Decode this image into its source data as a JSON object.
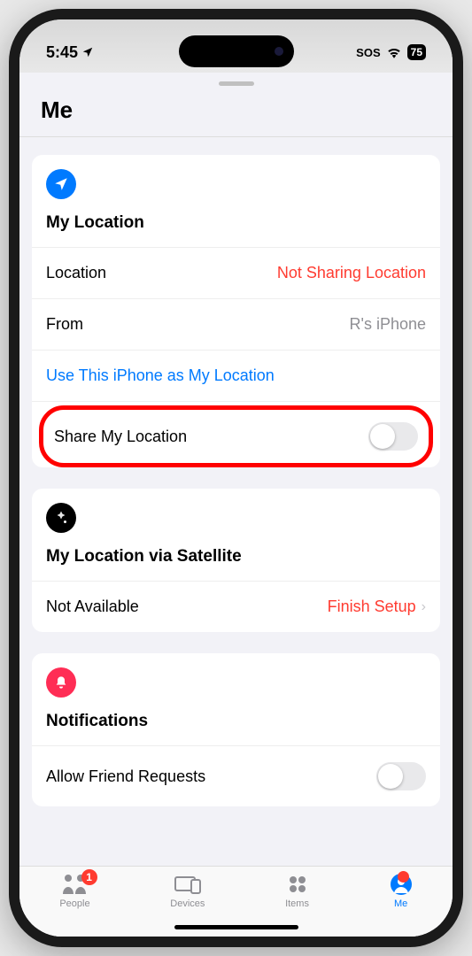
{
  "statusBar": {
    "time": "5:45",
    "sos": "SOS",
    "battery": "75"
  },
  "pageTitle": "Me",
  "locationCard": {
    "heading": "My Location",
    "rows": {
      "location": {
        "label": "Location",
        "value": "Not Sharing Location"
      },
      "from": {
        "label": "From",
        "value": "R's iPhone"
      }
    },
    "linkText": "Use This iPhone as My Location",
    "shareRow": {
      "label": "Share My Location",
      "toggle": false
    }
  },
  "satelliteCard": {
    "heading": "My Location via Satellite",
    "row": {
      "label": "Not Available",
      "value": "Finish Setup"
    }
  },
  "notificationsCard": {
    "heading": "Notifications",
    "row": {
      "label": "Allow Friend Requests",
      "toggle": false
    }
  },
  "tabs": {
    "people": {
      "label": "People",
      "badge": "1"
    },
    "devices": {
      "label": "Devices"
    },
    "items": {
      "label": "Items"
    },
    "me": {
      "label": "Me"
    }
  }
}
